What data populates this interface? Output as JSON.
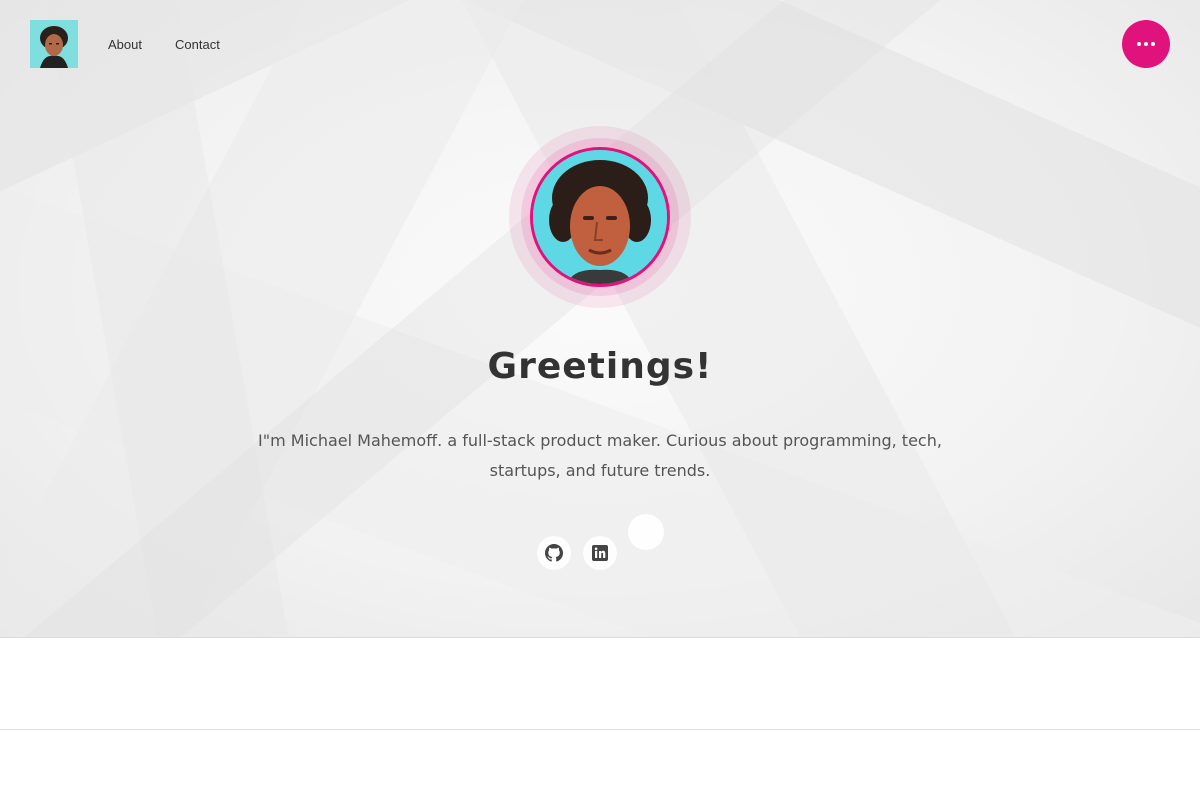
{
  "nav": {
    "items": [
      {
        "label": "About"
      },
      {
        "label": "Contact"
      }
    ],
    "menu_icon": "more-dots-icon"
  },
  "hero": {
    "headline": "Greetings!",
    "bio": "I\"m Michael Mahemoff. a full-stack product maker. Curious about programming, tech, startups, and future trends.",
    "social": [
      {
        "icon": "github-icon"
      },
      {
        "icon": "linkedin-icon"
      }
    ]
  },
  "colors": {
    "accent": "#e0127c",
    "avatar_bg": "#5fd8e6"
  }
}
